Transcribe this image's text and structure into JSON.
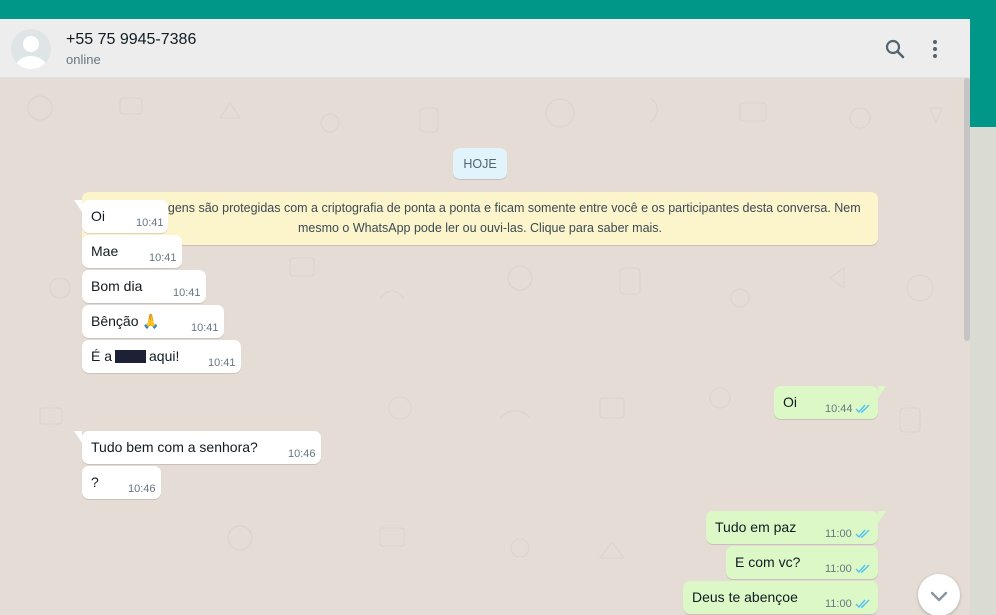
{
  "header": {
    "contact_name": "+55 75 9945-7386",
    "status": "online",
    "icons": [
      "avatar-placeholder",
      "search-icon",
      "kebab-menu-icon"
    ]
  },
  "date_chip": "HOJE",
  "encryption_notice": {
    "text": "As mensagens são protegidas com a criptografia de ponta a ponta e ficam somente entre você e os participantes desta conversa. Nem mesmo o WhatsApp pode ler ou ouvi-las. Clique para saber mais.",
    "icon": "lock-icon"
  },
  "messages": [
    {
      "dir": "in",
      "text": "Oi",
      "time": "10:41"
    },
    {
      "dir": "in",
      "text": "Mae",
      "time": "10:41"
    },
    {
      "dir": "in",
      "text": "Bom dia",
      "time": "10:41"
    },
    {
      "dir": "in",
      "text": "Bênção",
      "emoji": "🙏",
      "time": "10:41"
    },
    {
      "dir": "in",
      "text_before": "É a",
      "text_after": "aqui!",
      "time": "10:41",
      "redacted": true
    },
    {
      "dir": "out",
      "text": "Oi",
      "time": "10:44",
      "status": "read"
    },
    {
      "dir": "in",
      "text": "Tudo bem com a senhora?",
      "time": "10:46"
    },
    {
      "dir": "in",
      "text": "?",
      "time": "10:46"
    },
    {
      "dir": "out",
      "text": "Tudo em paz",
      "time": "11:00",
      "status": "read"
    },
    {
      "dir": "out",
      "text": "E com vc?",
      "time": "11:00",
      "status": "read"
    },
    {
      "dir": "out",
      "text": "Deus te abençoe",
      "time": "11:00",
      "status": "read"
    }
  ],
  "colors": {
    "teal": "#009688",
    "header_bg": "#ededed",
    "wallpaper": "#e5ddd5",
    "incoming_bubble": "#ffffff",
    "outgoing_bubble": "#dcf8c6",
    "notice_bg": "#fcf4cb",
    "date_chip_bg": "#e1f3fb",
    "read_ticks": "#4fc3f7"
  }
}
